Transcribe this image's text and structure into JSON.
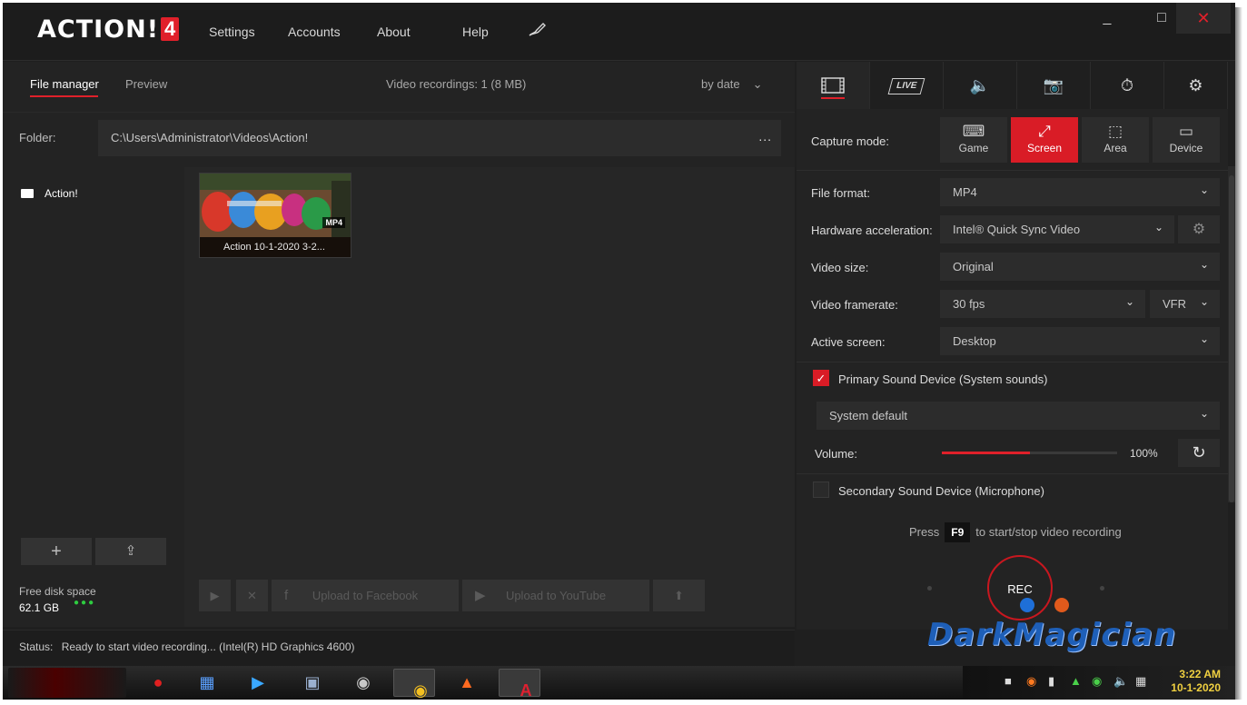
{
  "app": {
    "logo": "ACTION!",
    "logo_badge": "4",
    "menu": [
      "Settings",
      "Accounts",
      "About",
      "Help"
    ],
    "window": {
      "minimize": "_",
      "maximize": "□",
      "close": "✕"
    }
  },
  "file_manager": {
    "tabs": [
      "File manager",
      "Preview"
    ],
    "summary": "Video recordings: 1 (8 MB)",
    "sort": "by date",
    "folder_label": "Folder:",
    "folder_path": "C:\\Users\\Administrator\\Videos\\Action!",
    "folder_more": "...",
    "tree": [
      {
        "label": "Action!"
      }
    ],
    "add_button": "+",
    "folder_button": "⇪",
    "disk_label": "Free disk space",
    "disk_value": "62.1 GB",
    "disk_dots": "●●●",
    "thumbnail": {
      "title": "Action 10-1-2020 3-2...",
      "format": "MP4"
    },
    "actions": {
      "play": "▶",
      "delete": "✕",
      "facebook": "Upload to Facebook",
      "facebook_icon": "f",
      "youtube": "Upload to YouTube",
      "youtube_icon": "▶",
      "upload": "⬆"
    }
  },
  "status": {
    "label": "Status:",
    "text": "Ready to start video recording...  (Intel(R) HD Graphics 4600)"
  },
  "right_panel": {
    "tabs": [
      "video-tab",
      "live-tab",
      "audio-tab",
      "screenshot-tab",
      "timer-tab",
      "settings-tab"
    ],
    "live_label": "LIVE",
    "capture_mode_label": "Capture mode:",
    "capture_modes": [
      {
        "label": "Game",
        "glyph": "⌨"
      },
      {
        "label": "Screen",
        "glyph": "⤢"
      },
      {
        "label": "Area",
        "glyph": "⬚"
      },
      {
        "label": "Device",
        "glyph": "▭"
      }
    ],
    "capture_mode_selected": "Screen",
    "file_format_label": "File format:",
    "file_format": "MP4",
    "hw_accel_label": "Hardware acceleration:",
    "hw_accel": "Intel® Quick Sync Video",
    "video_size_label": "Video size:",
    "video_size": "Original",
    "framerate_label": "Video framerate:",
    "framerate": "30 fps",
    "framerate_mode": "VFR",
    "active_screen_label": "Active screen:",
    "active_screen": "Desktop",
    "primary_sound_label": "Primary Sound Device (System sounds)",
    "primary_sound_checked": true,
    "primary_sound_device": "System default",
    "volume_label": "Volume:",
    "volume_value": "100%",
    "volume_fraction": 0.5,
    "secondary_sound_label": "Secondary Sound Device (Microphone)",
    "secondary_sound_checked": false,
    "hint_pre": "Press",
    "hint_key": "F9",
    "hint_post": "to start/stop video recording",
    "rec_label": "REC"
  },
  "watermark": "DarkMagician",
  "taskbar": {
    "clock_time": "3:22 AM",
    "clock_date": "10-1-2020"
  },
  "colors": {
    "accent": "#d91c26",
    "background": "#1f1f1f",
    "panel": "#232323",
    "input": "#2c2c2c",
    "disk_ok": "#2ecc40"
  }
}
